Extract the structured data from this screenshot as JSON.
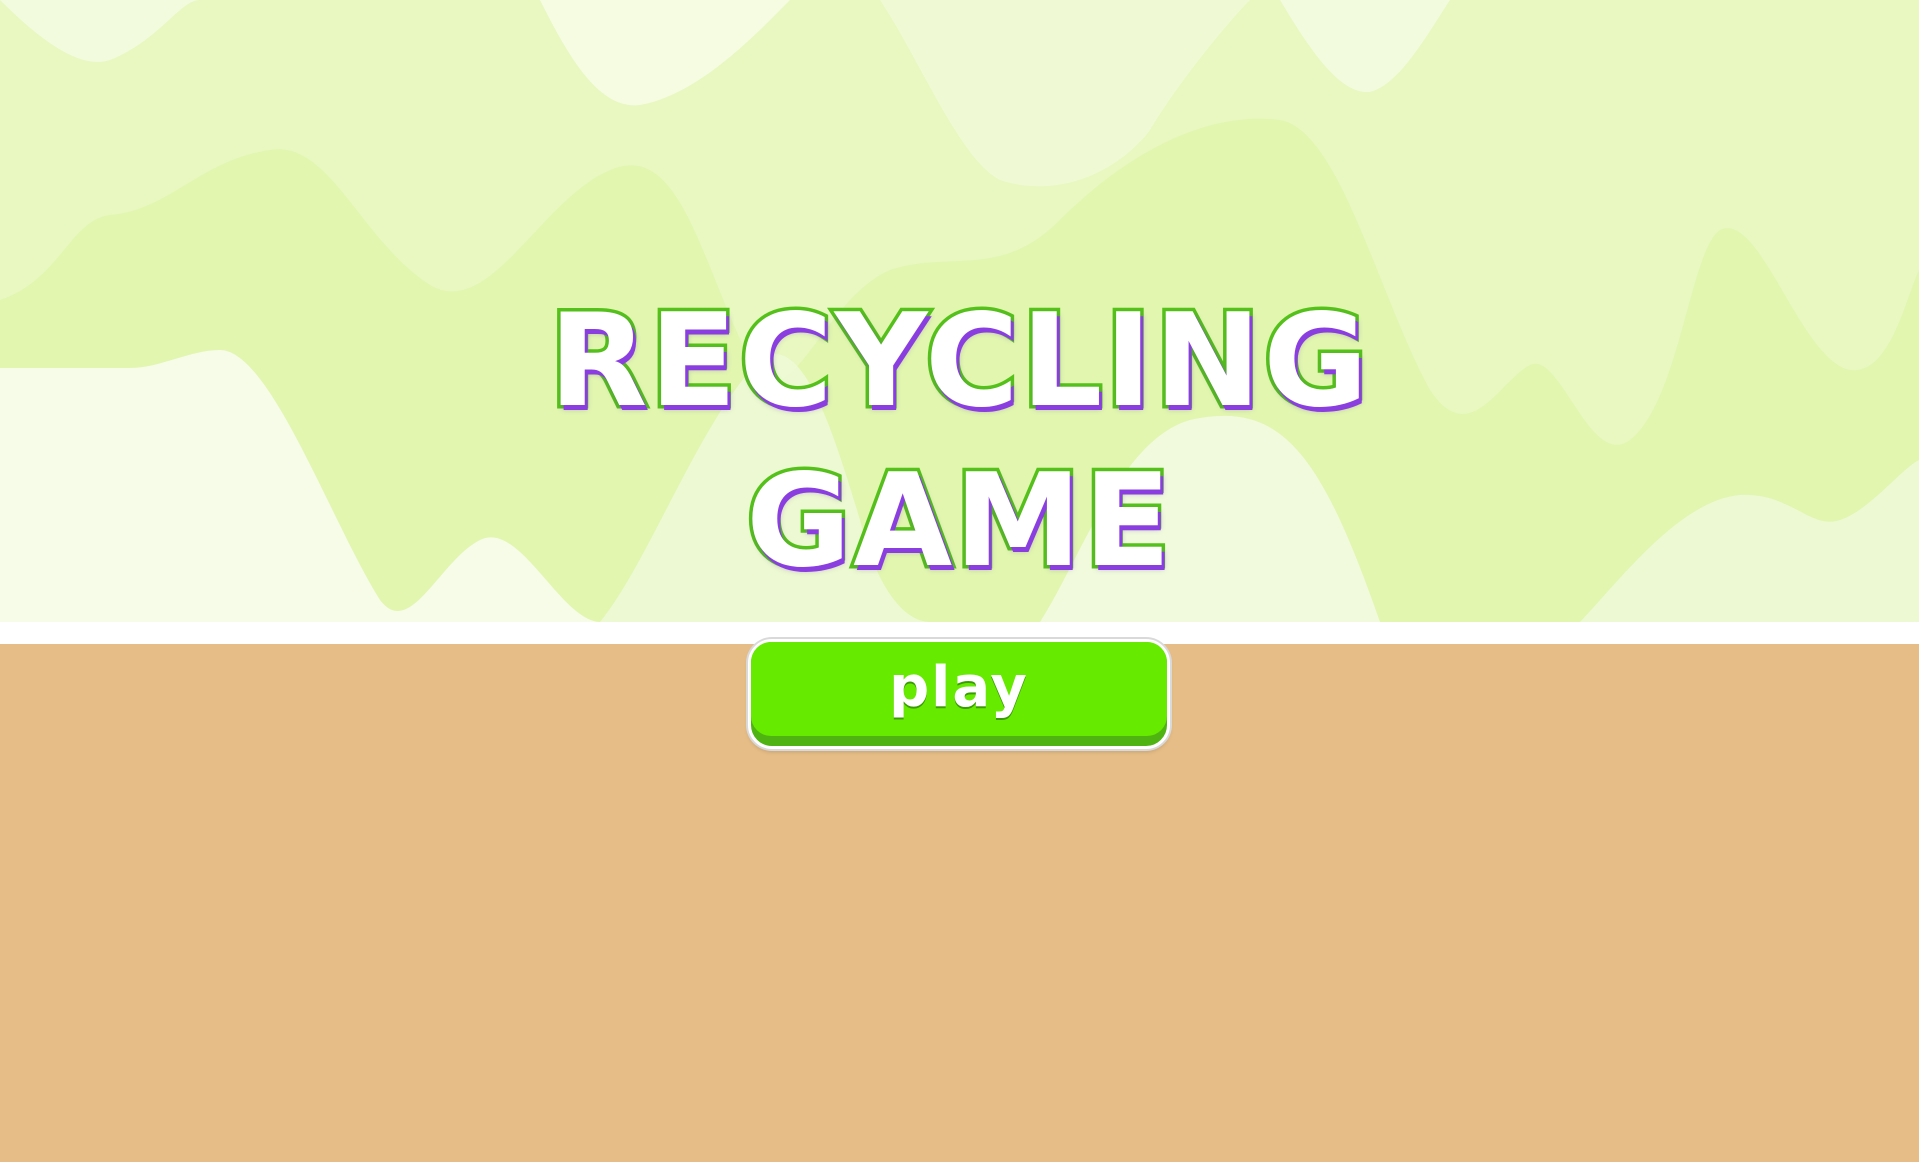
{
  "title": {
    "line1": "RECYCLING",
    "line2": "GAME"
  },
  "play_button": {
    "label": "play"
  },
  "colors": {
    "sky_light": "#f4fbe0",
    "sky_green": "#e4f8b5",
    "title_fill": "#ffffff",
    "title_outline": "#55c21a",
    "title_shadow": "#8a3ee0",
    "button_face": "#66ea00",
    "button_edge": "#4fb311",
    "ground": "#e6bd86"
  }
}
